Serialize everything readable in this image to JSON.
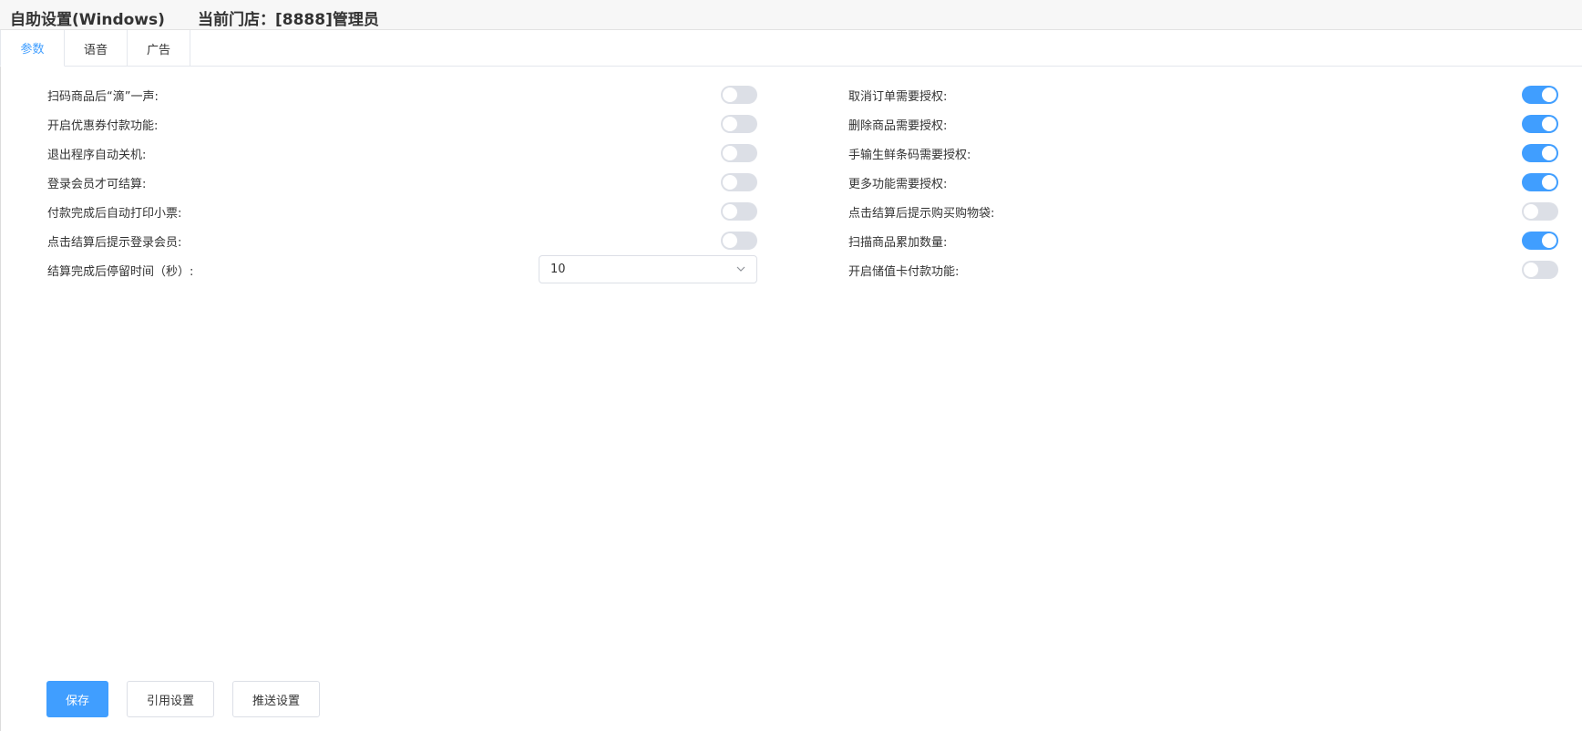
{
  "header": {
    "app_title": "自助设置(Windows)",
    "store_info": "当前门店：[8888]管理员"
  },
  "tabs": [
    {
      "label": "参数",
      "active": true
    },
    {
      "label": "语音",
      "active": false
    },
    {
      "label": "广告",
      "active": false
    }
  ],
  "left_settings": [
    {
      "label": "扫码商品后“滴”一声:",
      "on": false
    },
    {
      "label": "开启优惠券付款功能:",
      "on": false
    },
    {
      "label": "退出程序自动关机:",
      "on": false
    },
    {
      "label": "登录会员才可结算:",
      "on": false
    },
    {
      "label": "付款完成后自动打印小票:",
      "on": false
    },
    {
      "label": "点击结算后提示登录会员:",
      "on": false
    }
  ],
  "stay_time": {
    "label": "结算完成后停留时间（秒）:",
    "value": "10"
  },
  "right_settings": [
    {
      "label": "取消订单需要授权:",
      "on": true
    },
    {
      "label": "删除商品需要授权:",
      "on": true
    },
    {
      "label": "手输生鲜条码需要授权:",
      "on": true
    },
    {
      "label": "更多功能需要授权:",
      "on": true
    },
    {
      "label": "点击结算后提示购买购物袋:",
      "on": false
    },
    {
      "label": "扫描商品累加数量:",
      "on": true
    },
    {
      "label": "开启储值卡付款功能:",
      "on": false
    }
  ],
  "buttons": {
    "save": "保存",
    "quote": "引用设置",
    "push": "推送设置"
  },
  "colors": {
    "accent": "#409eff",
    "switch_off": "#dcdfe6",
    "border": "#e4e7ed"
  },
  "icons": {
    "select_arrow": "chevron-down-icon"
  }
}
